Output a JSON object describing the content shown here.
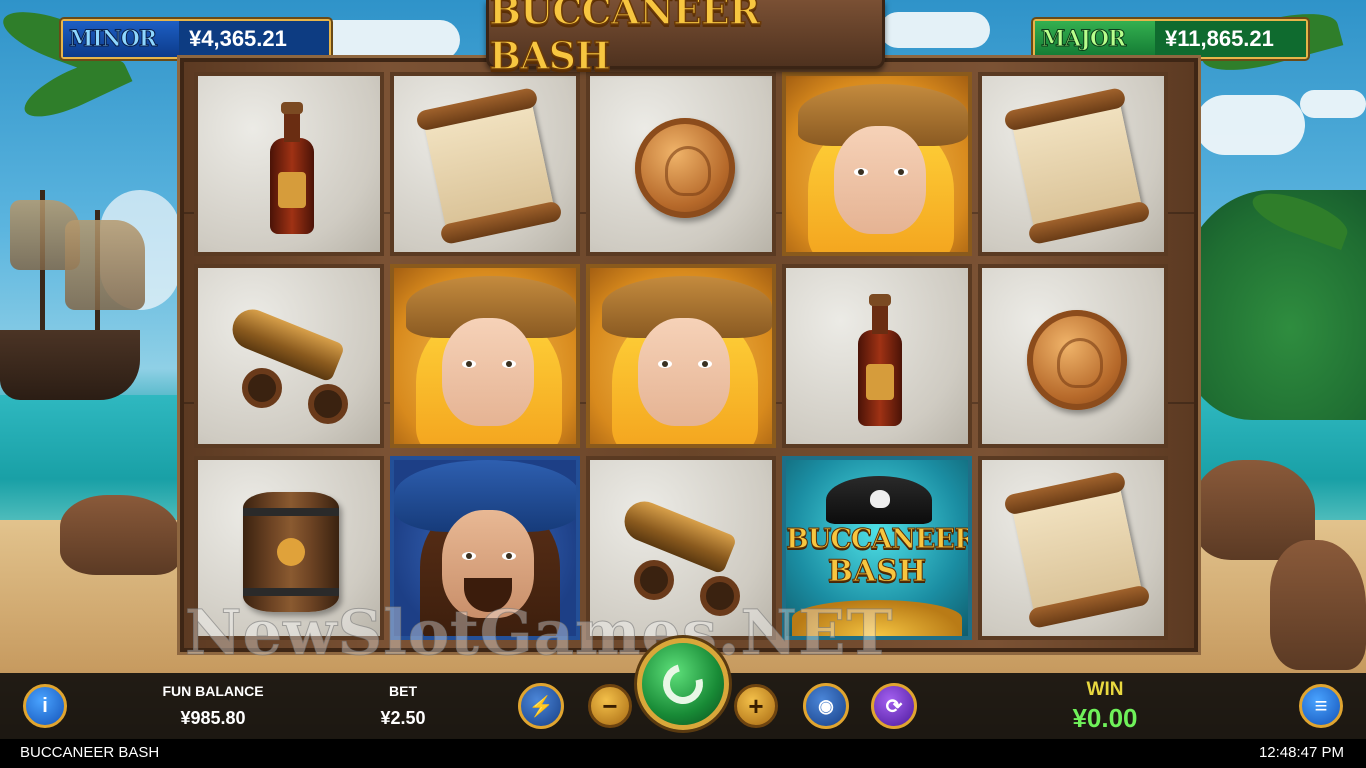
{
  "jackpots": {
    "minor": {
      "name": "MINOR",
      "value": "¥4,365.21"
    },
    "major": {
      "name": "MAJOR",
      "value": "¥11,865.21"
    }
  },
  "game_title": "BUCCANEER BASH",
  "reels": [
    [
      "rum-bottle",
      "treasure-map",
      "gold-coin",
      "pirate-woman",
      "treasure-map"
    ],
    [
      "cannon",
      "pirate-woman",
      "pirate-woman",
      "rum-bottle",
      "gold-coin"
    ],
    [
      "barrel",
      "pirate-captain",
      "cannon",
      "scatter-buccaneer-bash",
      "treasure-map"
    ]
  ],
  "scatter": {
    "line1": "BUCCANEER",
    "line2": "BASH"
  },
  "watermark": "NewSlotGames.NET",
  "balance": {
    "label": "FUN BALANCE",
    "value": "¥985.80"
  },
  "bet": {
    "label": "BET",
    "value": "¥2.50"
  },
  "win": {
    "label": "WIN",
    "value": "¥0.00"
  },
  "buttons": {
    "info": "i",
    "menu": "≡",
    "minus": "−",
    "plus": "+",
    "turbo_icon": "lightning-icon",
    "coins_icon": "coin-stack-icon",
    "autoplay_icon": "autoplay-icon",
    "spin_icon": "spin-arrow-icon"
  },
  "footer": {
    "title": "BUCCANEER BASH",
    "time": "12:48:47 PM"
  },
  "colors": {
    "win_label": "#e8d840",
    "win_value": "#6ff15a",
    "title_gold": "#f7c640"
  }
}
